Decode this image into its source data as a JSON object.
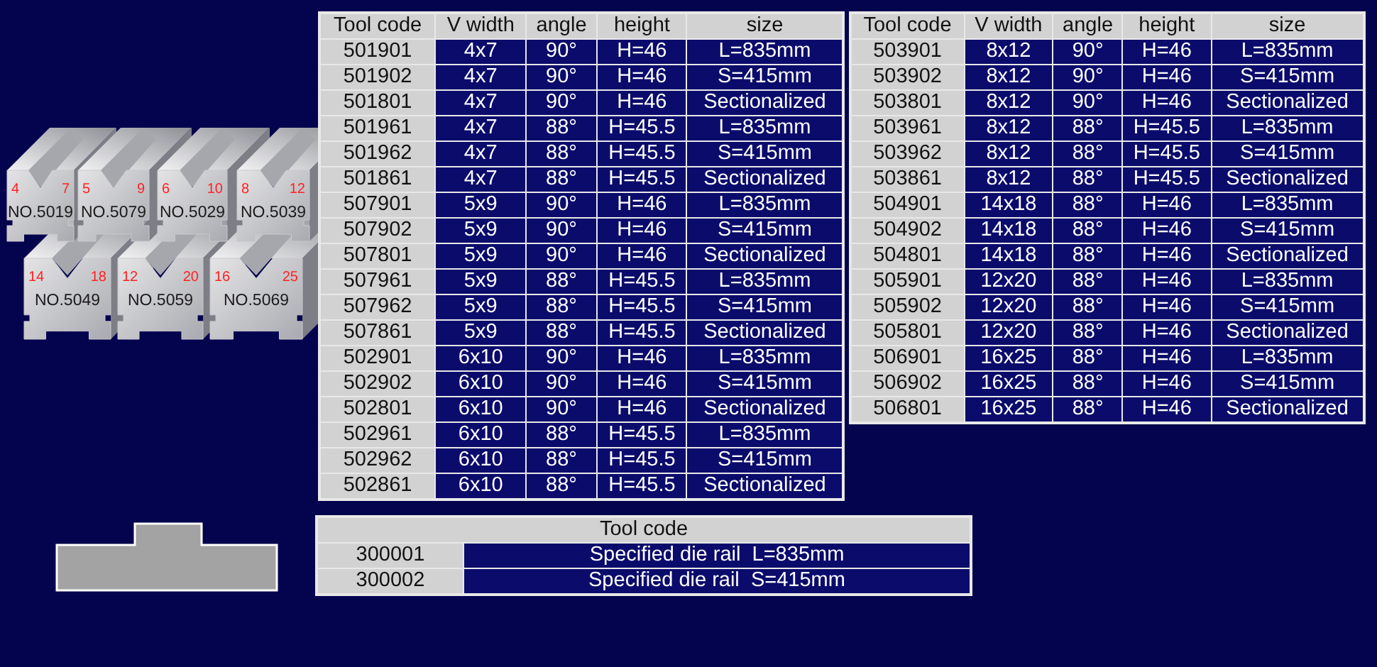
{
  "dies": [
    {
      "model": "NO.5019",
      "v_small": "4",
      "v_large": "7"
    },
    {
      "model": "NO.5079",
      "v_small": "5",
      "v_large": "9"
    },
    {
      "model": "NO.5029",
      "v_small": "6",
      "v_large": "10"
    },
    {
      "model": "NO.5039",
      "v_small": "8",
      "v_large": "12"
    },
    {
      "model": "NO.5049",
      "v_small": "14",
      "v_large": "18"
    },
    {
      "model": "NO.5059",
      "v_small": "12",
      "v_large": "20"
    },
    {
      "model": "NO.5069",
      "v_small": "16",
      "v_large": "25"
    }
  ],
  "left_table": {
    "columns": [
      "Tool code",
      "V width",
      "angle",
      "height",
      "size"
    ],
    "rows": [
      [
        "501901",
        "4x7",
        "90°",
        "H=46",
        "L=835mm"
      ],
      [
        "501902",
        "4x7",
        "90°",
        "H=46",
        "S=415mm"
      ],
      [
        "501801",
        "4x7",
        "90°",
        "H=46",
        "Sectionalized"
      ],
      [
        "501961",
        "4x7",
        "88°",
        "H=45.5",
        "L=835mm"
      ],
      [
        "501962",
        "4x7",
        "88°",
        "H=45.5",
        "S=415mm"
      ],
      [
        "501861",
        "4x7",
        "88°",
        "H=45.5",
        "Sectionalized"
      ],
      [
        "507901",
        "5x9",
        "90°",
        "H=46",
        "L=835mm"
      ],
      [
        "507902",
        "5x9",
        "90°",
        "H=46",
        "S=415mm"
      ],
      [
        "507801",
        "5x9",
        "90°",
        "H=46",
        "Sectionalized"
      ],
      [
        "507961",
        "5x9",
        "88°",
        "H=45.5",
        "L=835mm"
      ],
      [
        "507962",
        "5x9",
        "88°",
        "H=45.5",
        "S=415mm"
      ],
      [
        "507861",
        "5x9",
        "88°",
        "H=45.5",
        "Sectionalized"
      ],
      [
        "502901",
        "6x10",
        "90°",
        "H=46",
        "L=835mm"
      ],
      [
        "502902",
        "6x10",
        "90°",
        "H=46",
        "S=415mm"
      ],
      [
        "502801",
        "6x10",
        "90°",
        "H=46",
        "Sectionalized"
      ],
      [
        "502961",
        "6x10",
        "88°",
        "H=45.5",
        "L=835mm"
      ],
      [
        "502962",
        "6x10",
        "88°",
        "H=45.5",
        "S=415mm"
      ],
      [
        "502861",
        "6x10",
        "88°",
        "H=45.5",
        "Sectionalized"
      ]
    ]
  },
  "right_table": {
    "columns": [
      "Tool code",
      "V width",
      "angle",
      "height",
      "size"
    ],
    "rows": [
      [
        "503901",
        "8x12",
        "90°",
        "H=46",
        "L=835mm"
      ],
      [
        "503902",
        "8x12",
        "90°",
        "H=46",
        "S=415mm"
      ],
      [
        "503801",
        "8x12",
        "90°",
        "H=46",
        "Sectionalized"
      ],
      [
        "503961",
        "8x12",
        "88°",
        "H=45.5",
        "L=835mm"
      ],
      [
        "503962",
        "8x12",
        "88°",
        "H=45.5",
        "S=415mm"
      ],
      [
        "503861",
        "8x12",
        "88°",
        "H=45.5",
        "Sectionalized"
      ],
      [
        "504901",
        "14x18",
        "88°",
        "H=46",
        "L=835mm"
      ],
      [
        "504902",
        "14x18",
        "88°",
        "H=46",
        "S=415mm"
      ],
      [
        "504801",
        "14x18",
        "88°",
        "H=46",
        "Sectionalized"
      ],
      [
        "505901",
        "12x20",
        "88°",
        "H=46",
        "L=835mm"
      ],
      [
        "505902",
        "12x20",
        "88°",
        "H=46",
        "S=415mm"
      ],
      [
        "505801",
        "12x20",
        "88°",
        "H=46",
        "Sectionalized"
      ],
      [
        "506901",
        "16x25",
        "88°",
        "H=46",
        "L=835mm"
      ],
      [
        "506902",
        "16x25",
        "88°",
        "H=46",
        "S=415mm"
      ],
      [
        "506801",
        "16x25",
        "88°",
        "H=46",
        "Sectionalized"
      ]
    ]
  },
  "rail_table": {
    "title": "Tool code",
    "rows": [
      [
        "300001",
        "Specified die rail  L=835mm"
      ],
      [
        "300002",
        "Specified die rail  S=415mm"
      ]
    ]
  }
}
